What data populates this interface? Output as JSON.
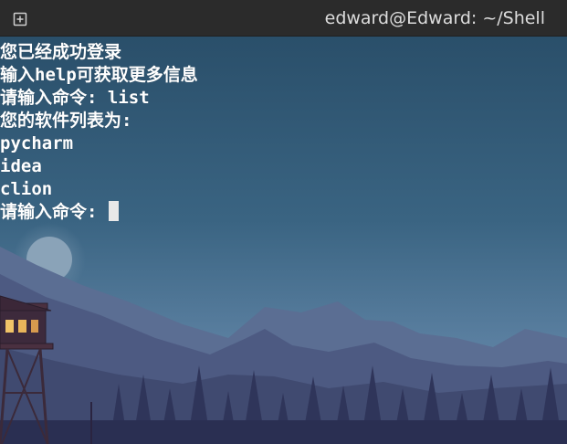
{
  "window": {
    "title": "edward@Edward: ~/Shell",
    "new_tab_icon": "new-tab-icon"
  },
  "terminal": {
    "lines": [
      "您已经成功登录",
      "输入help可获取更多信息",
      "请输入命令: list",
      "您的软件列表为:",
      "pycharm",
      "idea",
      "clion"
    ],
    "prompt": "请输入命令: "
  },
  "colors": {
    "titlebar": "#2b2b2b",
    "text": "#ffffff",
    "sky_top": "#2c5570",
    "sky_bottom": "#4a6d8c"
  }
}
